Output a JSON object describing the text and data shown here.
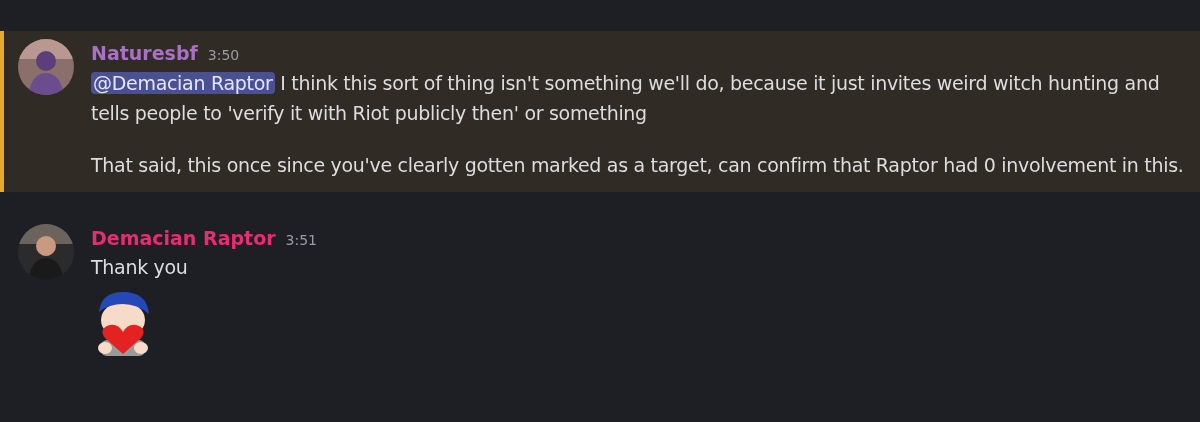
{
  "messages": [
    {
      "author": "Naturesbf",
      "color": "#a970c8",
      "time": "3:50",
      "highlighted": true,
      "paragraphs": [
        {
          "mention": "@Demacian Raptor",
          "text": " I think this sort of thing isn't something we'll do, because it just invites weird witch hunting and tells people to 'verify it with Riot publicly then' or something"
        },
        {
          "text": "That said, this once since you've clearly gotten marked as a target, can confirm that Raptor had 0 involvement in this."
        }
      ]
    },
    {
      "author": "Demacian Raptor",
      "color": "#e0306f",
      "time": "3:51",
      "highlighted": false,
      "paragraphs": [
        {
          "text": "Thank you"
        }
      ],
      "attachments": [
        {
          "kind": "sticker"
        }
      ]
    }
  ]
}
